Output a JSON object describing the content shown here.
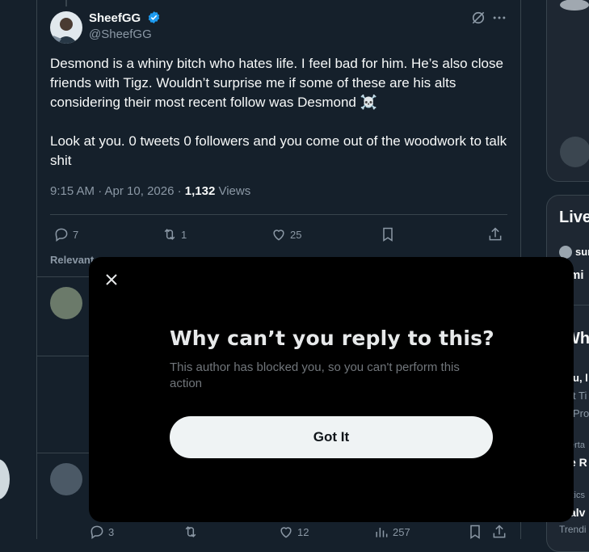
{
  "tweet": {
    "author_name": "SheefGG",
    "author_handle": "@SheefGG",
    "text_line1": "Desmond is a whiny bitch who hates life. I feel bad for him. He’s also close friends with Tigz. Wouldn’t surprise me if some of these are his alts considering their most recent follow was Desmond ☠️",
    "text_line2": "Look at you. 0 tweets 0 followers and you come out of the woodwork to talk shit",
    "timestamp": "9:15 AM · Apr 10, 2026 · ",
    "views_count": "1,132",
    "views_label": " Views",
    "replies": "7",
    "reposts": "1",
    "likes": "25",
    "relevant_label": "Relevant"
  },
  "bottom_actions": {
    "replies": "3",
    "likes": "12",
    "views": "257"
  },
  "right_column": {
    "live_heading": "Live",
    "user_snippet": "sur",
    "user_snippet2": "mi",
    "whats_heading": "Wha",
    "trend1": "u, l",
    "trend1_sub": "t Ti",
    "trend1_meta": "Pro",
    "trend2_meta": "erta",
    "trend2": "e R",
    "trend3_meta": "itics",
    "trend3": "alv",
    "trend4_meta": "Trendi"
  },
  "modal": {
    "title": "Why can’t you reply to this?",
    "body": "This author has blocked you, so you can't perform this action",
    "button_label": "Got It"
  },
  "colors": {
    "background": "#15202b",
    "modal_background": "#000000",
    "button_background": "#eff3f4",
    "verified_blue": "#1d9bf0"
  }
}
